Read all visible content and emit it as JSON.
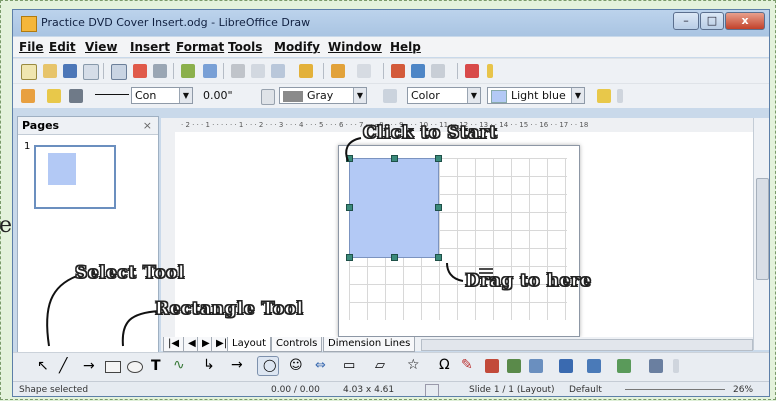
{
  "side_letter": "e",
  "window": {
    "title": "Practice DVD Cover Insert.odg - LibreOffice Draw",
    "buttons": {
      "minimize": "–",
      "maximize": "□",
      "close": "x"
    }
  },
  "menu": [
    "File",
    "Edit",
    "View",
    "Insert",
    "Format",
    "Tools",
    "Modify",
    "Window",
    "Help"
  ],
  "line_toolbar": {
    "line_style": "Con",
    "line_width": "0.00\"",
    "line_color": "Gray",
    "area_style": "Color",
    "area_color": "Light blue",
    "colors": {
      "line_color": "#8a8a8a",
      "area_color": "#b3c9f5"
    }
  },
  "pages_panel": {
    "title": "Pages",
    "close": "×",
    "thumbnails": [
      {
        "number": "1"
      }
    ]
  },
  "ruler_text": "· 2 · · · 1 · · · · · · 1 · · · 2 · · · 3 · · · 4 · · · 5 · · · 6 · · · 7 · · · 8 · · · 9 · · · 10 · · 11 · · 12 · · 13 · · 14 · · 15 · · 16 · · 17 · · 18",
  "tabs": {
    "nav": [
      "|◀",
      "◀",
      "▶",
      "▶|"
    ],
    "items": [
      "Layout",
      "Controls",
      "Dimension Lines"
    ],
    "active": "Layout"
  },
  "drawing_tools": [
    "select-arrow",
    "line",
    "arrow-line",
    "rectangle",
    "ellipse",
    "text",
    "curve",
    "connector",
    "line-ends",
    "basic-shapes",
    "symbol-shapes",
    "block-arrows",
    "flowchart",
    "callouts",
    "stars",
    "points",
    "glue-points",
    "fontwork",
    "from-file",
    "gallery",
    "extrusion"
  ],
  "status": {
    "message": "Shape selected",
    "position": "0.00 / 0.00",
    "size": "4.03 x 4.61",
    "slide": "Slide 1 / 1 (Layout)",
    "master": "Default",
    "zoom": "26%"
  },
  "callouts": {
    "click_to_start": "Click to Start",
    "drag_to_here": "Drag to here",
    "select_tool": "Select Tool",
    "rectangle_tool": "Rectangle Tool"
  }
}
